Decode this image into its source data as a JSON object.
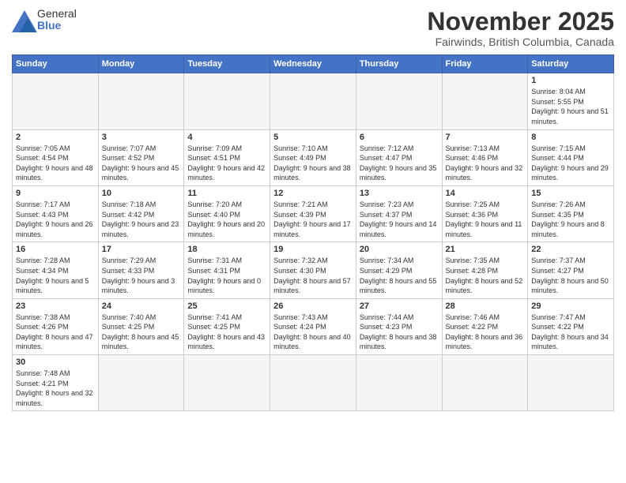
{
  "header": {
    "logo_line1": "General",
    "logo_line2": "Blue",
    "title": "November 2025",
    "location": "Fairwinds, British Columbia, Canada"
  },
  "days_of_week": [
    "Sunday",
    "Monday",
    "Tuesday",
    "Wednesday",
    "Thursday",
    "Friday",
    "Saturday"
  ],
  "weeks": [
    [
      {
        "day": "",
        "empty": true
      },
      {
        "day": "",
        "empty": true
      },
      {
        "day": "",
        "empty": true
      },
      {
        "day": "",
        "empty": true
      },
      {
        "day": "",
        "empty": true
      },
      {
        "day": "",
        "empty": true
      },
      {
        "day": "1",
        "sunrise": "8:04 AM",
        "sunset": "5:55 PM",
        "daylight": "9 hours and 51 minutes."
      }
    ],
    [
      {
        "day": "2",
        "sunrise": "7:05 AM",
        "sunset": "4:54 PM",
        "daylight": "9 hours and 48 minutes."
      },
      {
        "day": "3",
        "sunrise": "7:07 AM",
        "sunset": "4:52 PM",
        "daylight": "9 hours and 45 minutes."
      },
      {
        "day": "4",
        "sunrise": "7:09 AM",
        "sunset": "4:51 PM",
        "daylight": "9 hours and 42 minutes."
      },
      {
        "day": "5",
        "sunrise": "7:10 AM",
        "sunset": "4:49 PM",
        "daylight": "9 hours and 38 minutes."
      },
      {
        "day": "6",
        "sunrise": "7:12 AM",
        "sunset": "4:47 PM",
        "daylight": "9 hours and 35 minutes."
      },
      {
        "day": "7",
        "sunrise": "7:13 AM",
        "sunset": "4:46 PM",
        "daylight": "9 hours and 32 minutes."
      },
      {
        "day": "8",
        "sunrise": "7:15 AM",
        "sunset": "4:44 PM",
        "daylight": "9 hours and 29 minutes."
      }
    ],
    [
      {
        "day": "9",
        "sunrise": "7:17 AM",
        "sunset": "4:43 PM",
        "daylight": "9 hours and 26 minutes."
      },
      {
        "day": "10",
        "sunrise": "7:18 AM",
        "sunset": "4:42 PM",
        "daylight": "9 hours and 23 minutes."
      },
      {
        "day": "11",
        "sunrise": "7:20 AM",
        "sunset": "4:40 PM",
        "daylight": "9 hours and 20 minutes."
      },
      {
        "day": "12",
        "sunrise": "7:21 AM",
        "sunset": "4:39 PM",
        "daylight": "9 hours and 17 minutes."
      },
      {
        "day": "13",
        "sunrise": "7:23 AM",
        "sunset": "4:37 PM",
        "daylight": "9 hours and 14 minutes."
      },
      {
        "day": "14",
        "sunrise": "7:25 AM",
        "sunset": "4:36 PM",
        "daylight": "9 hours and 11 minutes."
      },
      {
        "day": "15",
        "sunrise": "7:26 AM",
        "sunset": "4:35 PM",
        "daylight": "9 hours and 8 minutes."
      }
    ],
    [
      {
        "day": "16",
        "sunrise": "7:28 AM",
        "sunset": "4:34 PM",
        "daylight": "9 hours and 5 minutes."
      },
      {
        "day": "17",
        "sunrise": "7:29 AM",
        "sunset": "4:33 PM",
        "daylight": "9 hours and 3 minutes."
      },
      {
        "day": "18",
        "sunrise": "7:31 AM",
        "sunset": "4:31 PM",
        "daylight": "9 hours and 0 minutes."
      },
      {
        "day": "19",
        "sunrise": "7:32 AM",
        "sunset": "4:30 PM",
        "daylight": "8 hours and 57 minutes."
      },
      {
        "day": "20",
        "sunrise": "7:34 AM",
        "sunset": "4:29 PM",
        "daylight": "8 hours and 55 minutes."
      },
      {
        "day": "21",
        "sunrise": "7:35 AM",
        "sunset": "4:28 PM",
        "daylight": "8 hours and 52 minutes."
      },
      {
        "day": "22",
        "sunrise": "7:37 AM",
        "sunset": "4:27 PM",
        "daylight": "8 hours and 50 minutes."
      }
    ],
    [
      {
        "day": "23",
        "sunrise": "7:38 AM",
        "sunset": "4:26 PM",
        "daylight": "8 hours and 47 minutes."
      },
      {
        "day": "24",
        "sunrise": "7:40 AM",
        "sunset": "4:25 PM",
        "daylight": "8 hours and 45 minutes."
      },
      {
        "day": "25",
        "sunrise": "7:41 AM",
        "sunset": "4:25 PM",
        "daylight": "8 hours and 43 minutes."
      },
      {
        "day": "26",
        "sunrise": "7:43 AM",
        "sunset": "4:24 PM",
        "daylight": "8 hours and 40 minutes."
      },
      {
        "day": "27",
        "sunrise": "7:44 AM",
        "sunset": "4:23 PM",
        "daylight": "8 hours and 38 minutes."
      },
      {
        "day": "28",
        "sunrise": "7:46 AM",
        "sunset": "4:22 PM",
        "daylight": "8 hours and 36 minutes."
      },
      {
        "day": "29",
        "sunrise": "7:47 AM",
        "sunset": "4:22 PM",
        "daylight": "8 hours and 34 minutes."
      }
    ],
    [
      {
        "day": "30",
        "sunrise": "7:48 AM",
        "sunset": "4:21 PM",
        "daylight": "8 hours and 32 minutes."
      },
      {
        "day": "",
        "empty": true
      },
      {
        "day": "",
        "empty": true
      },
      {
        "day": "",
        "empty": true
      },
      {
        "day": "",
        "empty": true
      },
      {
        "day": "",
        "empty": true
      },
      {
        "day": "",
        "empty": true
      }
    ]
  ]
}
